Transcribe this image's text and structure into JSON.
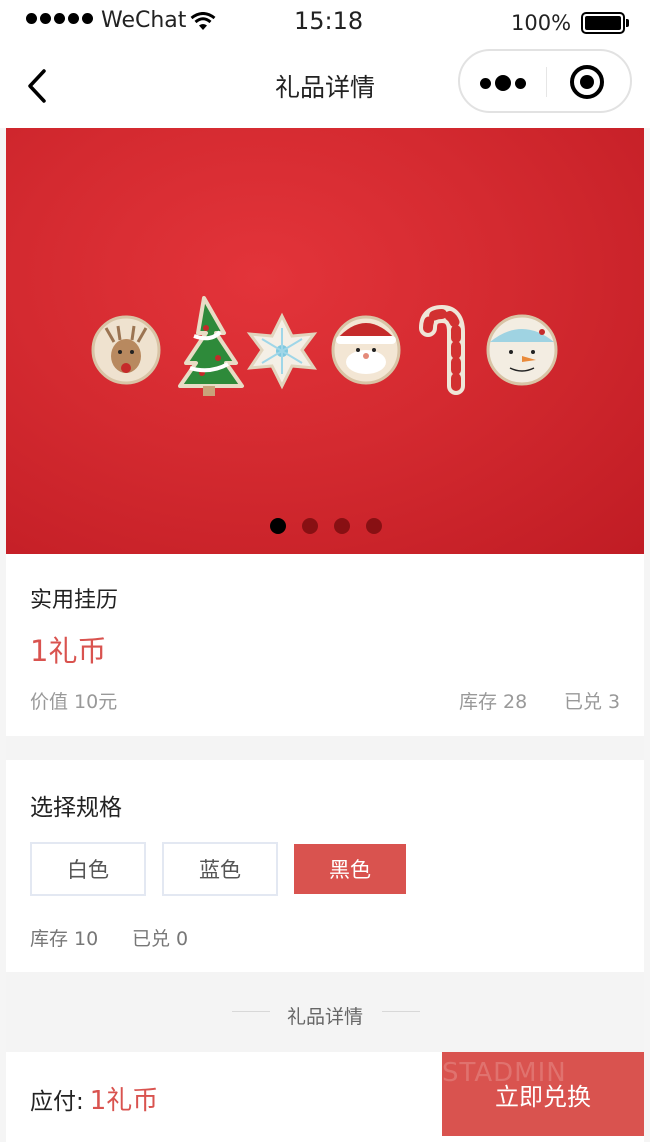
{
  "status_bar": {
    "carrier": "WeChat",
    "time": "15:18",
    "battery": "100%"
  },
  "nav": {
    "title": "礼品详情"
  },
  "banner": {
    "total_slides": 4,
    "active_slide": 1
  },
  "product": {
    "name": "实用挂历",
    "price": "1礼币",
    "value_label": "价值",
    "value": "10元",
    "stock": "库存 28",
    "redeemed": "已兑 3"
  },
  "spec": {
    "label": "选择规格",
    "options": [
      "白色",
      "蓝色",
      "黑色"
    ],
    "selected": "黑色",
    "stock": "库存 10",
    "redeemed": "已兑 0"
  },
  "detail": {
    "heading": "礼品详情"
  },
  "footer": {
    "pay_label": "应付:",
    "pay_amount": "1礼币",
    "watermark": "STADMIN",
    "action_label": "立即兑换"
  },
  "colors": {
    "accent": "#d9534f",
    "banner_red": "#d42a30"
  }
}
